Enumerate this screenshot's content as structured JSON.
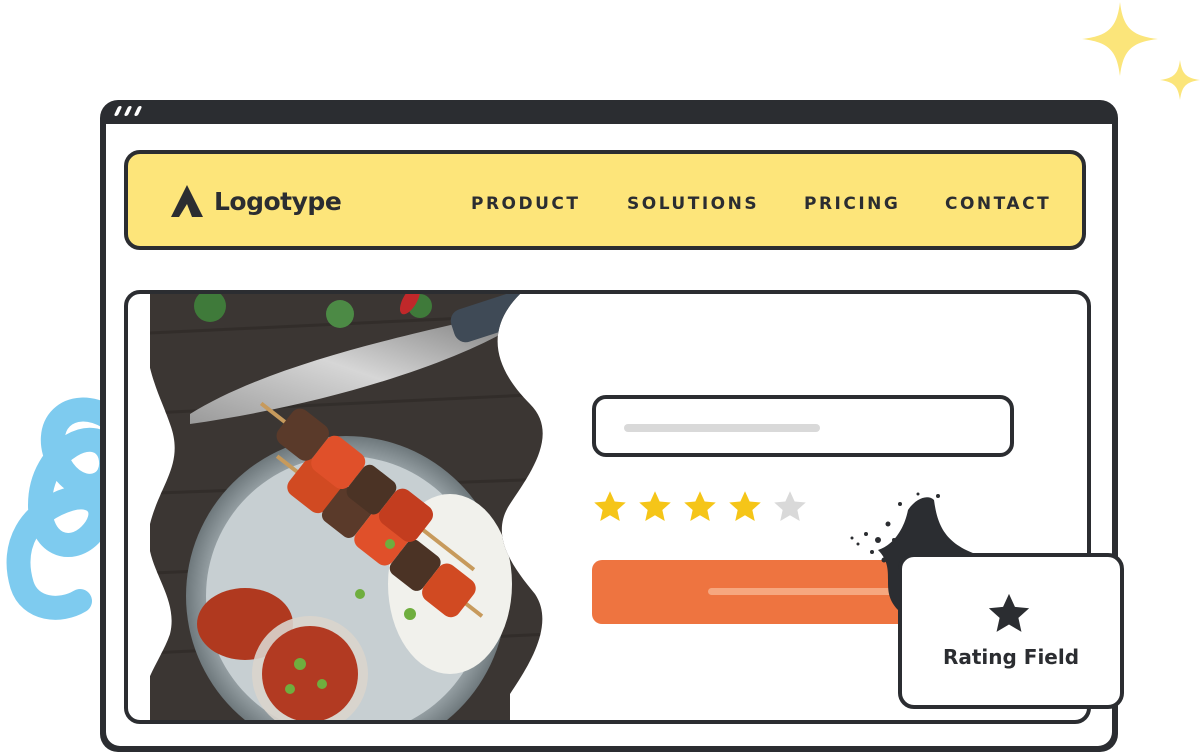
{
  "brand": {
    "name": "Logotype",
    "logo_icon": "logo-mark-icon"
  },
  "nav": {
    "items": [
      {
        "label": "PRODUCT"
      },
      {
        "label": "SOLUTIONS"
      },
      {
        "label": "PRICING"
      },
      {
        "label": "CONTACT"
      }
    ]
  },
  "rating": {
    "value": 4,
    "max": 5
  },
  "badge": {
    "label": "Rating Field",
    "icon": "star-icon"
  },
  "colors": {
    "nav_bg": "#fde57a",
    "star_filled": "#f5c518",
    "star_empty": "#d9d9d9",
    "button": "#ee7440",
    "outline": "#2b2d31",
    "squiggle": "#7ecbef",
    "sparkle": "#fbe57a"
  }
}
